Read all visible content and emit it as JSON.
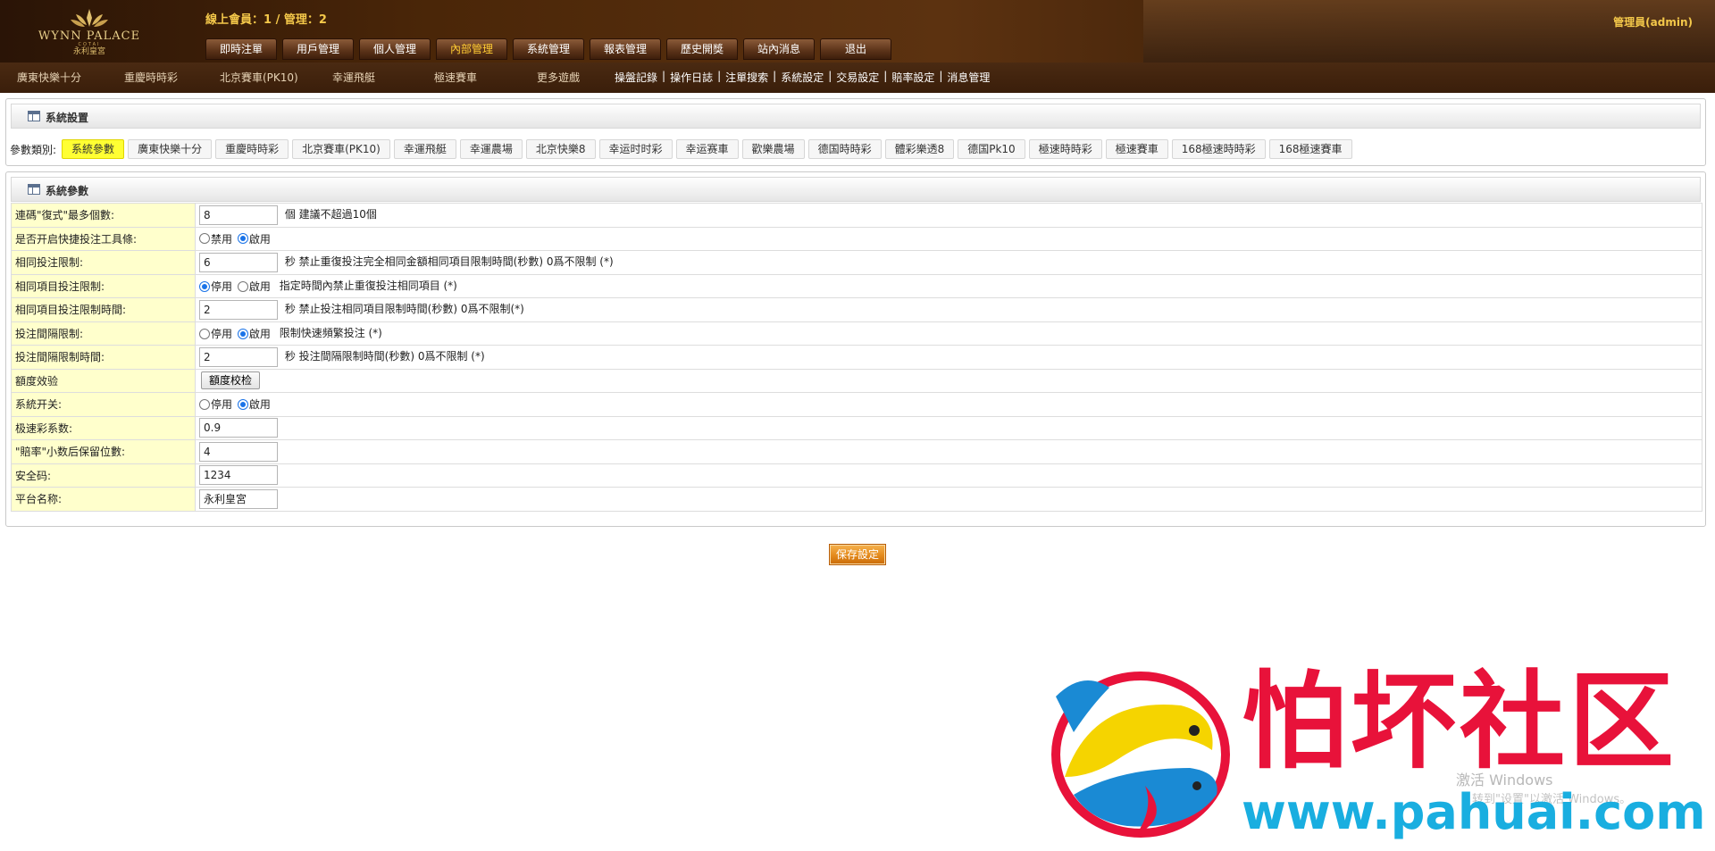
{
  "header": {
    "logo_main": "WYNN PALACE",
    "logo_small": "COTAI",
    "logo_sub": "永利皇宮",
    "online_stat": "線上會員：1 / 管理：2",
    "admin_label": "管理員(admin)",
    "nav": [
      {
        "label": "即時注單"
      },
      {
        "label": "用戶管理"
      },
      {
        "label": "個人管理"
      },
      {
        "label": "內部管理",
        "active": true
      },
      {
        "label": "系統管理"
      },
      {
        "label": "報表管理"
      },
      {
        "label": "歷史開獎"
      },
      {
        "label": "站內消息"
      },
      {
        "label": "退出"
      }
    ]
  },
  "subbar": {
    "lottery_tabs": [
      "廣東快樂十分",
      "重慶時時彩",
      "北京賽車(PK10)",
      "幸運飛艇",
      "極速賽車",
      "更多遊戲"
    ],
    "links": [
      "操盤記錄",
      "操作日誌",
      "注單搜索",
      "系統設定",
      "交易設定",
      "賠率設定",
      "消息管理"
    ]
  },
  "system_panel": {
    "title": "系統設置",
    "category_label": "參數類別:",
    "categories": [
      "系統參數",
      "廣東快樂十分",
      "重慶時時彩",
      "北京賽車(PK10)",
      "幸運飛艇",
      "幸運農場",
      "北京快樂8",
      "幸运时时彩",
      "幸运赛車",
      "歡樂農場",
      "德国時時彩",
      "體彩樂透8",
      "德国Pk10",
      "極速時時彩",
      "極速賽車",
      "168極速時時彩",
      "168極速賽車"
    ],
    "active_category": "系統參數"
  },
  "params_panel": {
    "title": "系統參數",
    "rows": {
      "max_multi": {
        "label": "連碼\"復式\"最多個數:",
        "value": "8",
        "hint": "個 建議不超過10個"
      },
      "quick_bet": {
        "label": "是否开启快捷投注工具條:",
        "opt1": "禁用",
        "opt2": "啟用"
      },
      "same_bet_limit": {
        "label": "相同投注限制:",
        "value": "6",
        "hint": "秒 禁止重復投注完全相同金額相同項目限制時間(秒數) 0爲不限制 (*)"
      },
      "same_item_limit": {
        "label": "相同項目投注限制:",
        "opt1": "停用",
        "opt2": "啟用",
        "hint": "指定時間內禁止重復投注相同項目 (*)"
      },
      "same_item_time": {
        "label": "相同項目投注限制時間:",
        "value": "2",
        "hint": "秒 禁止投注相同項目限制時間(秒數) 0爲不限制(*)"
      },
      "interval_limit": {
        "label": "投注間隔限制:",
        "opt1": "停用",
        "opt2": "啟用",
        "hint": "限制快速頻繁投注 (*)"
      },
      "interval_time": {
        "label": "投注間隔限制時間:",
        "value": "2",
        "hint": "秒 投注間隔限制時間(秒數) 0爲不限制 (*)"
      },
      "quota_check": {
        "label": "額度效验",
        "button": "額度校检"
      },
      "system_switch": {
        "label": "系統开关:",
        "opt1": "停用",
        "opt2": "啟用"
      },
      "speed_coef": {
        "label": "极速彩系数:",
        "value": "0.9"
      },
      "odds_decimals": {
        "label": "\"賠率\"小数后保留位數:",
        "value": "4"
      },
      "security_code": {
        "label": "安全码:",
        "value": "1234"
      },
      "platform_name": {
        "label": "平台名称:",
        "value": "永利皇宮"
      }
    }
  },
  "save_button": "保存設定",
  "watermark": {
    "title": "怕坏社区",
    "url": "www.pahuai.com",
    "win_activate": "激活 Windows",
    "win_activate_sub": "转到\"设置\"以激活 Windows。"
  },
  "colors": {
    "header_brown": "#4a2608",
    "nav_active": "#ffcc33",
    "label_bg": "#ffffcc",
    "category_active": "#ffff33",
    "save_orange": "#e48a1c",
    "watermark_red": "#e8123a",
    "watermark_blue": "#19aee0"
  }
}
